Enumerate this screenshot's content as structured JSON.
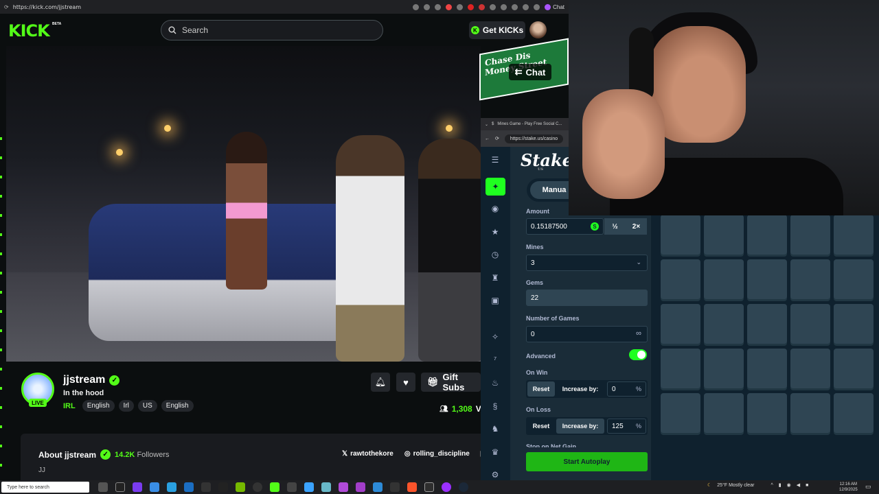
{
  "browser": {
    "url": "https://kick.com/jjstream",
    "chat_ext_label": "Chat"
  },
  "kick_header": {
    "logo": "KICK",
    "beta": "BETA",
    "search_placeholder": "Search",
    "get_kicks": "Get KICKs"
  },
  "video": {
    "chat_button": "Chat",
    "street_sign": "Chase Dis Money Street"
  },
  "channel": {
    "name": "jjstream",
    "live": "LIVE",
    "title": "In the hood",
    "category": "IRL",
    "tags": [
      "English",
      "Irl",
      "US",
      "English"
    ],
    "gift_subs": "Gift Subs",
    "viewers": "1,308",
    "viewers_suffix": "Vi"
  },
  "about": {
    "title": "About jjstream",
    "followers_count": "14.2K",
    "followers_label": "Followers",
    "bio": "JJ",
    "socials": [
      "rawtothekore",
      "rolling_discipline"
    ]
  },
  "stake_browser": {
    "tab_title": "Mines Game - Play Free Social C...",
    "url": "https://stake.us/casino"
  },
  "stake": {
    "logo": "Stake",
    "logo_sub": "US",
    "tab_manual": "Manua",
    "amount_label": "Amount",
    "amount_value": "0.15187500",
    "half": "½",
    "double": "2×",
    "mines_label": "Mines",
    "mines_value": "3",
    "gems_label": "Gems",
    "gems_value": "22",
    "games_label": "Number of Games",
    "games_value": "0",
    "advanced_label": "Advanced",
    "on_win_label": "On Win",
    "on_win_reset": "Reset",
    "on_win_increase": "Increase by:",
    "on_win_value": "0",
    "on_loss_label": "On Loss",
    "on_loss_reset": "Reset",
    "on_loss_increase": "Increase by:",
    "on_loss_value": "125",
    "pct": "%",
    "stop_label": "Stop on Net Gain",
    "autoplay": "Start Autoplay",
    "coin": "S",
    "grid_rows": 5,
    "grid_cols": 5
  },
  "taskbar": {
    "search_placeholder": "Type here to search",
    "weather": "25°F  Mostly clear",
    "time": "12:16 AM",
    "date": "12/9/2025"
  },
  "colors": {
    "kick_green": "#53fc18",
    "stake_green": "#1fff20",
    "stake_bg": "#1a2c38",
    "stake_dark": "#0f212e"
  }
}
